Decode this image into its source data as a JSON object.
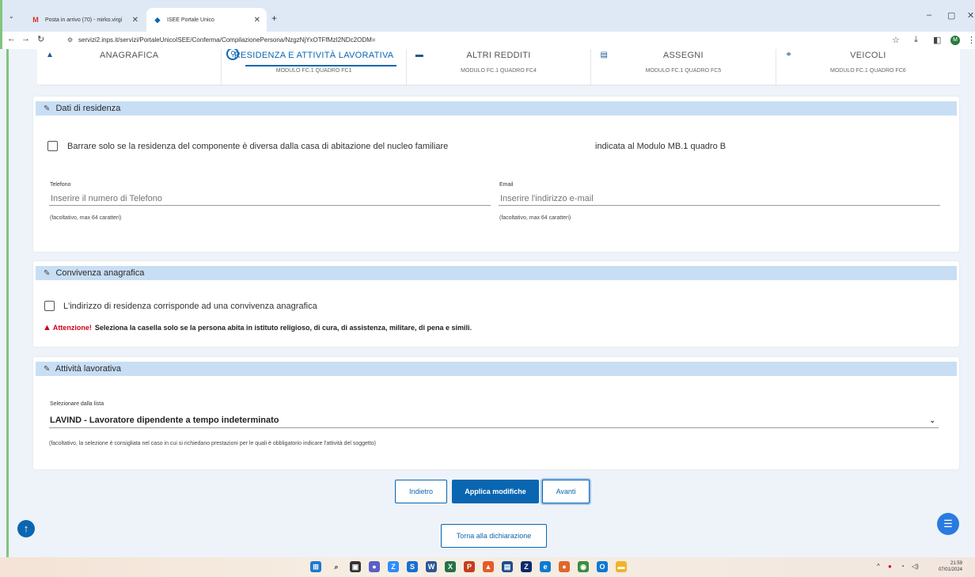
{
  "browser": {
    "tabs": [
      {
        "title": "Posta in arrivo (70) - mirko.virgi",
        "active": false,
        "icon": "gmail-icon"
      },
      {
        "title": "ISEE Portale Unico",
        "active": true,
        "icon": "inps-icon"
      }
    ],
    "url": "servizi2.inps.it/servizi/PortaleUnicoISEE/Conferma/CompilazionePersona/NzgzNjYxOTFfMzI2NDc2ODM=",
    "profile_initial": "M"
  },
  "steps": [
    {
      "label": "ANAGRAFICA",
      "sub": "",
      "icon": "person-icon"
    },
    {
      "label": "RESIDENZA E ATTIVITÀ LAVORATIVA",
      "sub": "MODULO FC.1 QUADRO FC1",
      "icon": "location-icon",
      "active": true
    },
    {
      "label": "ALTRI REDDITI",
      "sub": "MODULO FC.1 QUADRO FC4",
      "icon": "wallet-icon"
    },
    {
      "label": "ASSEGNI",
      "sub": "MODULO FC.1 QUADRO FC5",
      "icon": "card-icon"
    },
    {
      "label": "VEICOLI",
      "sub": "MODULO FC.1 QUADRO FC6",
      "icon": "vehicle-icon"
    }
  ],
  "residenza": {
    "title": "Dati di residenza",
    "checkbox_label_1": "Barrare solo se la residenza del componente è diversa dalla casa di abitazione del nucleo familiare",
    "checkbox_label_2": "indicata al Modulo MB.1 quadro B",
    "phone": {
      "label": "Telefono",
      "placeholder": "Inserire il numero di Telefono",
      "help": "(facoltativo, max 64 caratteri)"
    },
    "email": {
      "label": "Email",
      "placeholder": "Inserire l'indirizzo e-mail",
      "help": "(facoltativo, max 64 caratteri)"
    }
  },
  "convivenza": {
    "title": "Convivenza anagrafica",
    "checkbox_label": "L'indirizzo di residenza corrisponde ad una convivenza anagrafica",
    "warning_word": "Attenzione!",
    "warning_text": "Seleziona la casella solo se la persona abita in istituto religioso, di cura, di assistenza, militare, di pena e simili."
  },
  "attivita": {
    "title": "Attività lavorativa",
    "select_label": "Selezionare dalla lista",
    "select_value": "LAVIND - Lavoratore dipendente a tempo indeterminato",
    "help": "(facoltativo, la selezione è consigliata nel caso in cui si richiedano prestazioni per le quali è obbligatorio indicare l'attività del soggetto)"
  },
  "actions": {
    "back": "Indietro",
    "apply": "Applica modifiche",
    "next": "Avanti",
    "return": "Torna alla dichiarazione"
  },
  "taskbar": {
    "time": "21:59",
    "date": "07/01/2024"
  },
  "colors": {
    "primary": "#0a66b1",
    "section_header": "#c8def4",
    "warning": "#d0021b"
  }
}
